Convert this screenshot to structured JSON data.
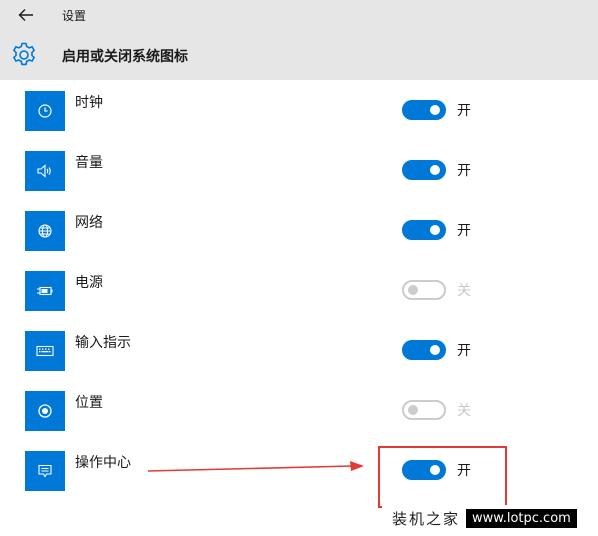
{
  "app": {
    "title": "设置"
  },
  "header": {
    "title": "启用或关闭系统图标"
  },
  "colors": {
    "accent": "#0078d7",
    "header_bg": "#e6e6e6",
    "annotation": "#e53935"
  },
  "rows": [
    {
      "label": "时钟",
      "icon": "clock-icon",
      "on": true,
      "state": "开"
    },
    {
      "label": "音量",
      "icon": "volume-icon",
      "on": true,
      "state": "开"
    },
    {
      "label": "网络",
      "icon": "globe-icon",
      "on": true,
      "state": "开"
    },
    {
      "label": "电源",
      "icon": "battery-icon",
      "on": false,
      "state": "关"
    },
    {
      "label": "输入指示",
      "icon": "keyboard-icon",
      "on": true,
      "state": "开"
    },
    {
      "label": "位置",
      "icon": "location-icon",
      "on": false,
      "state": "关"
    },
    {
      "label": "操作中心",
      "icon": "action-center-icon",
      "on": true,
      "state": "开"
    }
  ],
  "watermark": {
    "brand": "装机之家",
    "url": "www.lotpc.com"
  }
}
